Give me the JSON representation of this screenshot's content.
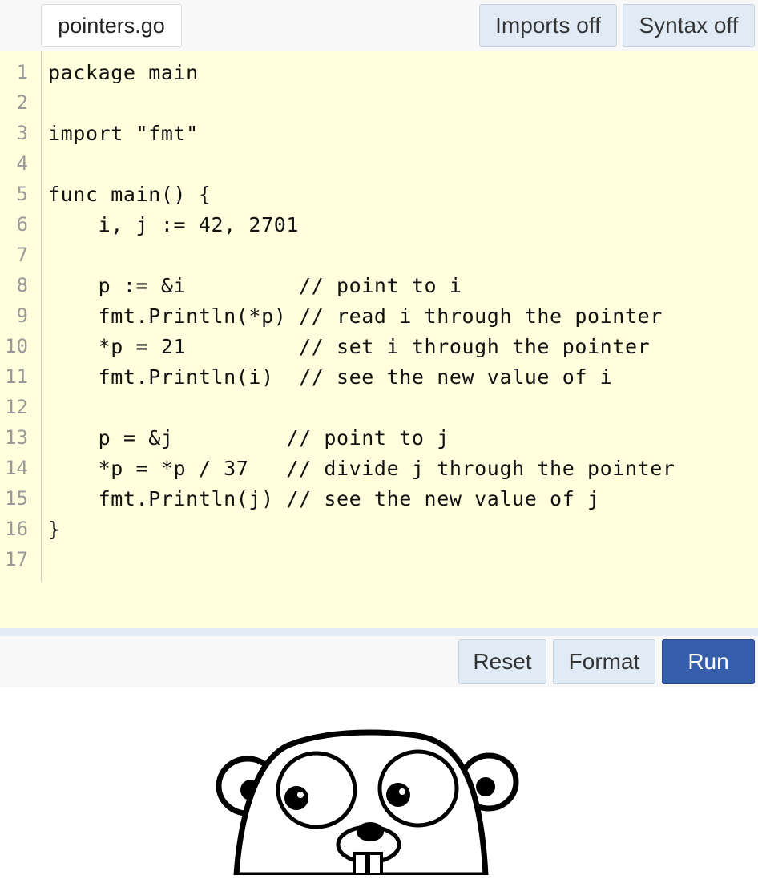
{
  "header": {
    "file_tab": "pointers.go",
    "imports_label": "Imports off",
    "syntax_label": "Syntax off"
  },
  "editor": {
    "lines": [
      "package main",
      "",
      "import \"fmt\"",
      "",
      "func main() {",
      "    i, j := 42, 2701",
      "",
      "    p := &i         // point to i",
      "    fmt.Println(*p) // read i through the pointer",
      "    *p = 21         // set i through the pointer",
      "    fmt.Println(i)  // see the new value of i",
      "",
      "    p = &j         // point to j",
      "    *p = *p / 37   // divide j through the pointer",
      "    fmt.Println(j) // see the new value of j",
      "}",
      ""
    ],
    "line_numbers": [
      "1",
      "2",
      "3",
      "4",
      "5",
      "6",
      "7",
      "8",
      "9",
      "10",
      "11",
      "12",
      "13",
      "14",
      "15",
      "16",
      "17"
    ]
  },
  "footer": {
    "reset_label": "Reset",
    "format_label": "Format",
    "run_label": "Run"
  },
  "colors": {
    "editor_bg": "#ffffdd",
    "button_bg": "#e0ebf5",
    "run_bg": "#375eab"
  },
  "icons": {
    "mascot": "gopher-mascot-icon"
  }
}
